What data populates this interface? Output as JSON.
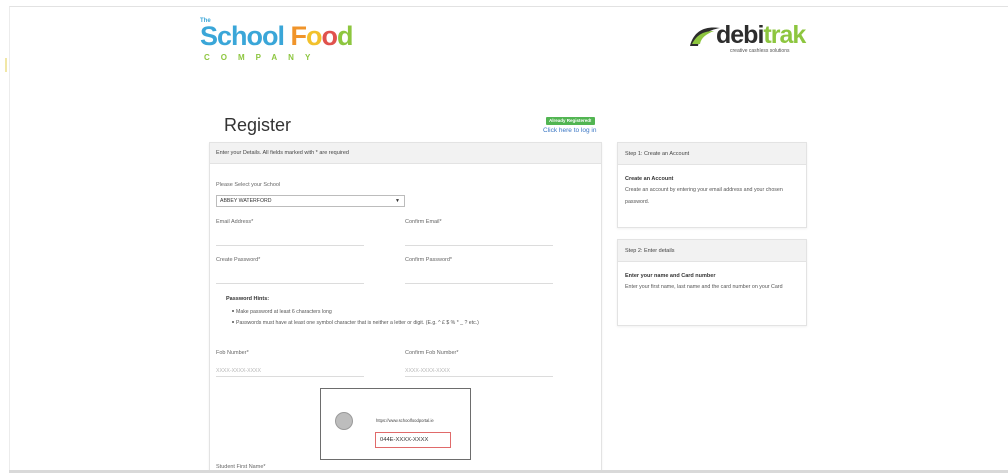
{
  "logos": {
    "school_food": {
      "the": "The",
      "school": "School ",
      "food_f": "F",
      "food_o1": "o",
      "food_o2": "o",
      "food_d": "d",
      "company": "COMPANY"
    },
    "debitrak": {
      "debi": "debi",
      "trak": "trak",
      "tagline": "creative cashless solutions"
    }
  },
  "register": {
    "title": "Register",
    "already_registered": "Already Registered!",
    "login_link": "Click here to log in"
  },
  "form": {
    "header": "Enter your Details. All fields marked with * are required",
    "school_label": "Please Select your School",
    "school_value": "ABBEY WATERFORD",
    "email_label": "Email Address*",
    "confirm_email_label": "Confirm Email*",
    "password_label": "Create Password*",
    "confirm_password_label": "Confirm Password*",
    "hints_title": "Password Hints:",
    "hints": [
      "Make password at least 6 characters long",
      "Passwords must have at least one symbol character that is neither a letter or digit. (E.g. ^ £ $ % * _ ? etc.)"
    ],
    "fob_label": "Fob Number*",
    "fob_placeholder": "XXXX-XXXX-XXXX",
    "confirm_fob_label": "Confirm Fob Number*",
    "confirm_fob_placeholder": "XXXX-XXXX-XXXX",
    "card_url": "https://www.schoolfoodportal.ie",
    "card_number": "044E-XXXX-XXXX",
    "student_first_name_label": "Student First Name*"
  },
  "steps": [
    {
      "header": "Step 1: Create an Account",
      "subtitle": "Create an Account",
      "text": "Create an account by entering your email address and your chosen password."
    },
    {
      "header": "Step 2: Enter details",
      "subtitle": "Enter your name and Card number",
      "text": "Enter your first name, last name and the card number on your Card"
    }
  ],
  "colors": {
    "accent_blue": "#3a76c4",
    "badge_green": "#52b552",
    "brand_green": "#8dc63f",
    "brand_blue": "#3aa6d8",
    "card_highlight": "#e06a6a"
  }
}
